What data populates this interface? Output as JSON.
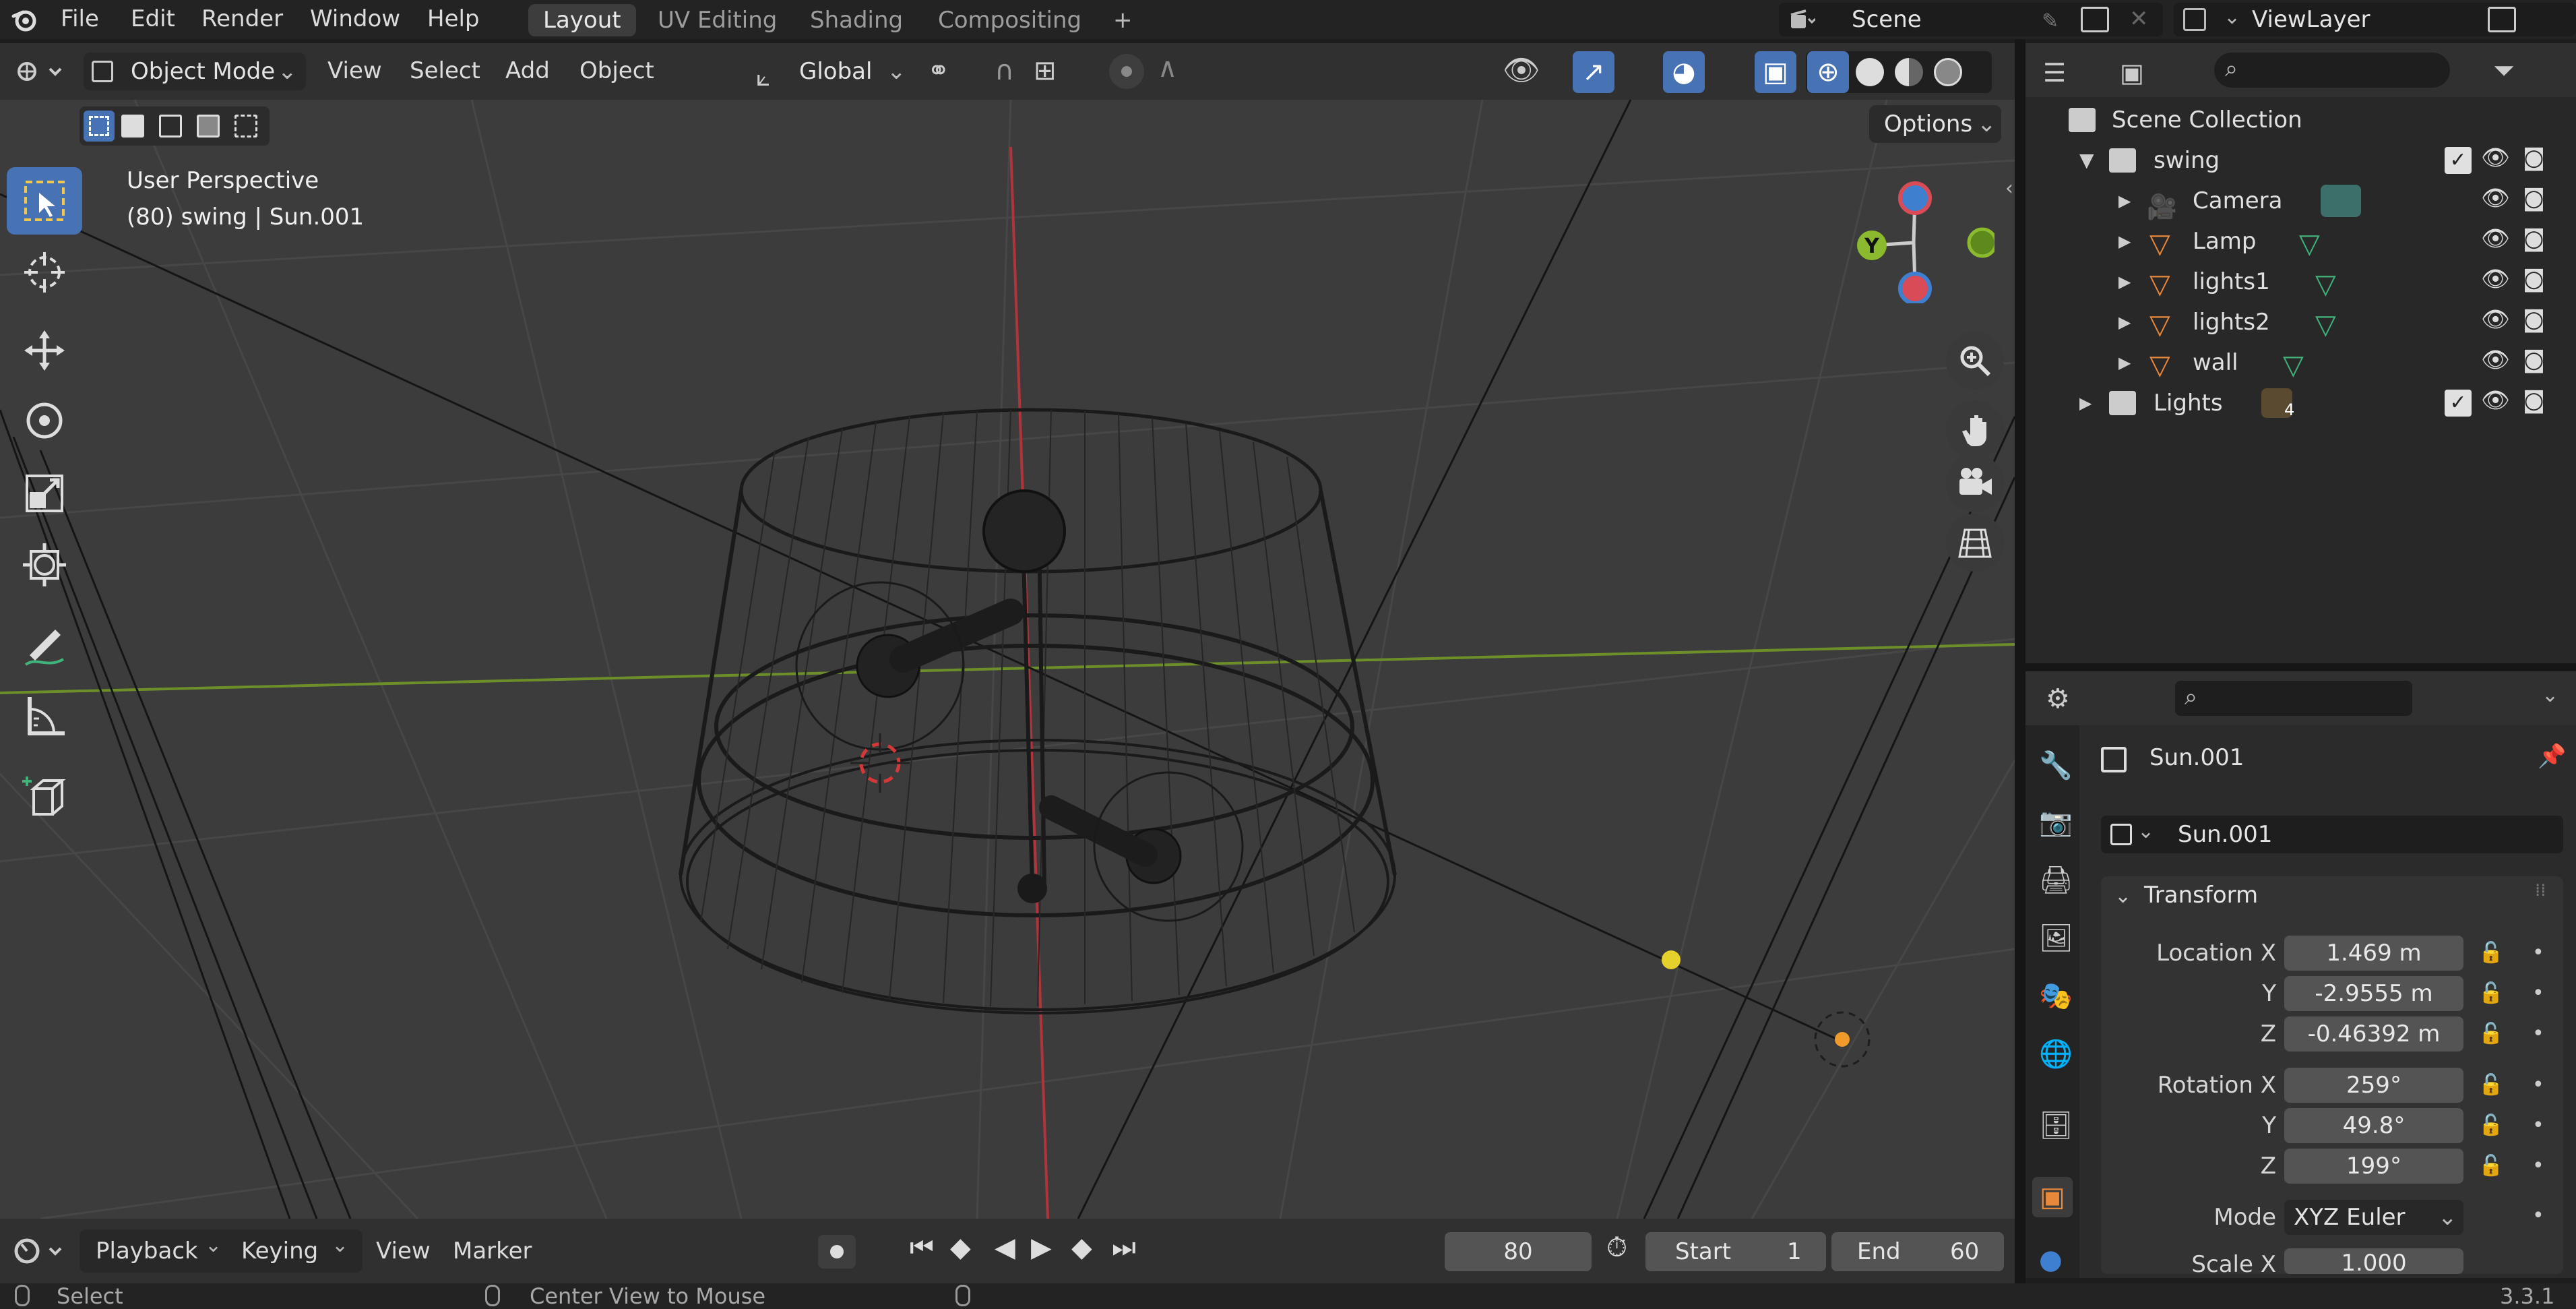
{
  "topbar": {
    "menus": [
      "File",
      "Edit",
      "Render",
      "Window",
      "Help"
    ],
    "workspaces": [
      "Layout",
      "UV Editing",
      "Shading",
      "Compositing"
    ],
    "add_workspace": "+",
    "scene": "Scene",
    "view_layer": "ViewLayer"
  },
  "viewport_header": {
    "mode": "Object Mode",
    "menus": [
      "View",
      "Select",
      "Add",
      "Object"
    ],
    "orientation": "Global"
  },
  "viewport": {
    "options": "Options",
    "perspective": "User Perspective",
    "context": "(80) swing | Sun.001",
    "gizmo": {
      "y": "Y"
    }
  },
  "outliner": {
    "root": "Scene Collection",
    "items": [
      {
        "label": "swing",
        "kind": "collection"
      },
      {
        "label": "Camera",
        "kind": "camera"
      },
      {
        "label": "Lamp",
        "kind": "mesh"
      },
      {
        "label": "lights1",
        "kind": "mesh"
      },
      {
        "label": "lights2",
        "kind": "mesh"
      },
      {
        "label": "wall",
        "kind": "mesh"
      },
      {
        "label": "Lights",
        "kind": "collection",
        "badge": "4"
      }
    ]
  },
  "properties": {
    "object": "Sun.001",
    "data_name": "Sun.001",
    "panel": "Transform",
    "location": {
      "label": "Location X",
      "x": "1.469 m",
      "y": "-2.9555 m",
      "z": "-0.46392 m"
    },
    "rotation": {
      "label": "Rotation X",
      "x": "259°",
      "y": "49.8°",
      "z": "199°"
    },
    "axis_y": "Y",
    "axis_z": "Z",
    "mode_label": "Mode",
    "mode_value": "XYZ Euler",
    "scale_label": "Scale X",
    "scale_x": "1.000"
  },
  "timeline": {
    "menus": [
      "Playback",
      "Keying",
      "View",
      "Marker"
    ],
    "current_frame": "80",
    "start_label": "Start",
    "start": "1",
    "end_label": "End",
    "end": "60"
  },
  "statusbar": {
    "select": "Select",
    "center": "Center View to Mouse",
    "version": "3.3.1"
  },
  "colors": {
    "accent": "#4772b3",
    "active_orange": "#e8883a",
    "x_axis": "#d94c57",
    "y_axis": "#8cba2e",
    "z_axis": "#3f7fd0"
  }
}
